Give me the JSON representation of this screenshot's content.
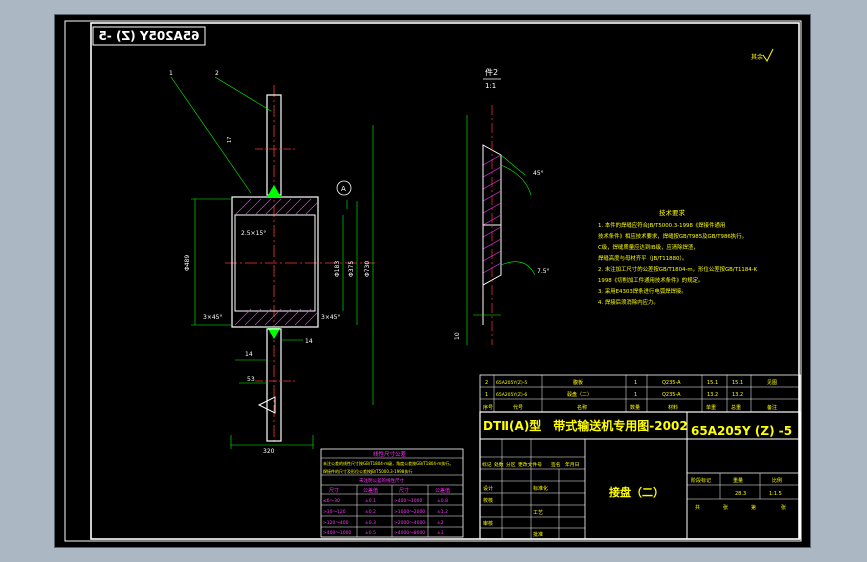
{
  "drawing": {
    "mirrored_code": "65A205Y (Z) -5",
    "detail_title": "件2",
    "detail_scale": "1:1",
    "roughness_note": "其余",
    "dims": {
      "d_left": "Φ489",
      "d_mid": "Φ375",
      "d_inner": "Φ183",
      "d_outer": "Φ730",
      "w_bottom": "320",
      "chamfer_tl": "2.5×15°",
      "chamfer_bl": "3×45°",
      "chamfer_br": "3×45°",
      "d14a": "14",
      "d14b": "14",
      "d53": "53",
      "d10": "10",
      "a45": "45°",
      "a75": "7.5°",
      "leader1": "1",
      "leader2": "2",
      "d17": "17",
      "datum": "A"
    },
    "tech_req": {
      "title": "技术要求",
      "lines": [
        "1. 本件的焊缝应符合JB/T5000.3-1998《焊接件通用",
        "   技术条件》相应技术要求，焊缝按GB/T985及GB/T986执行。",
        "   C级，焊缝质量应达到IB级，应清除焊渣，",
        "   焊缝高度与母材齐平（JB/T11880）。",
        "2. 未注加工尺寸的公差按GB/T1804-m，形位公差按GB/T1184-K",
        "   1998《切削加工件通用技术条件》的规定。",
        "3. 采用E4303焊条进行电弧焊焊接。",
        "4. 焊接后须消除内应力。"
      ]
    },
    "tolerance_table": {
      "title": "线性尺寸公差",
      "note": "未注公差的线性尺寸按GB/T1804-m级，角度公差按GB/T1804-m执行。",
      "note2": "焊接件的尺寸及形位公差按JB/T5000.3-1998执行",
      "sub": "未注明公差的线性尺寸",
      "headers": [
        "尺寸",
        "公差值",
        "尺寸",
        "公差值"
      ],
      "rows": [
        [
          "≤6～30",
          "±0.1",
          ">400～1000",
          "±0.8"
        ],
        [
          ">30～120",
          "±0.2",
          ">1000～2000",
          "±1.2"
        ],
        [
          ">120～400",
          "±0.3",
          ">2000～4000",
          "±2"
        ],
        [
          ">400～1000",
          "±0.5",
          ">4000～8000",
          "±3"
        ]
      ]
    },
    "bom": {
      "rows": [
        [
          "2",
          "65A205Y(Z)-5",
          "腹板",
          "1",
          "Q235-A",
          "15.1",
          "15.1",
          "见图"
        ],
        [
          "1",
          "65A205Y(Z)-6",
          "毂盘（二）",
          "1",
          "Q235-A",
          "13.2",
          "13.2",
          ""
        ]
      ],
      "header": [
        "序号",
        "代号",
        "名称",
        "数量",
        "材料",
        "单重",
        "总重",
        "备注"
      ]
    },
    "title_block": {
      "banner": "DTⅡ(A)型　带式输送机专用图-2002",
      "code": "65A205Y (Z) -5",
      "part_name": "接盘（二）",
      "mass": "28.3",
      "scale": "1:1.5",
      "labels": [
        "标记",
        "处数",
        "分区",
        "更改文件号",
        "签名",
        "年月日"
      ],
      "roles": [
        "设计",
        "校核",
        "工艺",
        "标准化",
        "审核",
        "批准"
      ],
      "stage_labels": [
        "阶段标记",
        "重量",
        "比例"
      ],
      "sheet": [
        "共",
        "张",
        "第",
        "张"
      ]
    }
  }
}
